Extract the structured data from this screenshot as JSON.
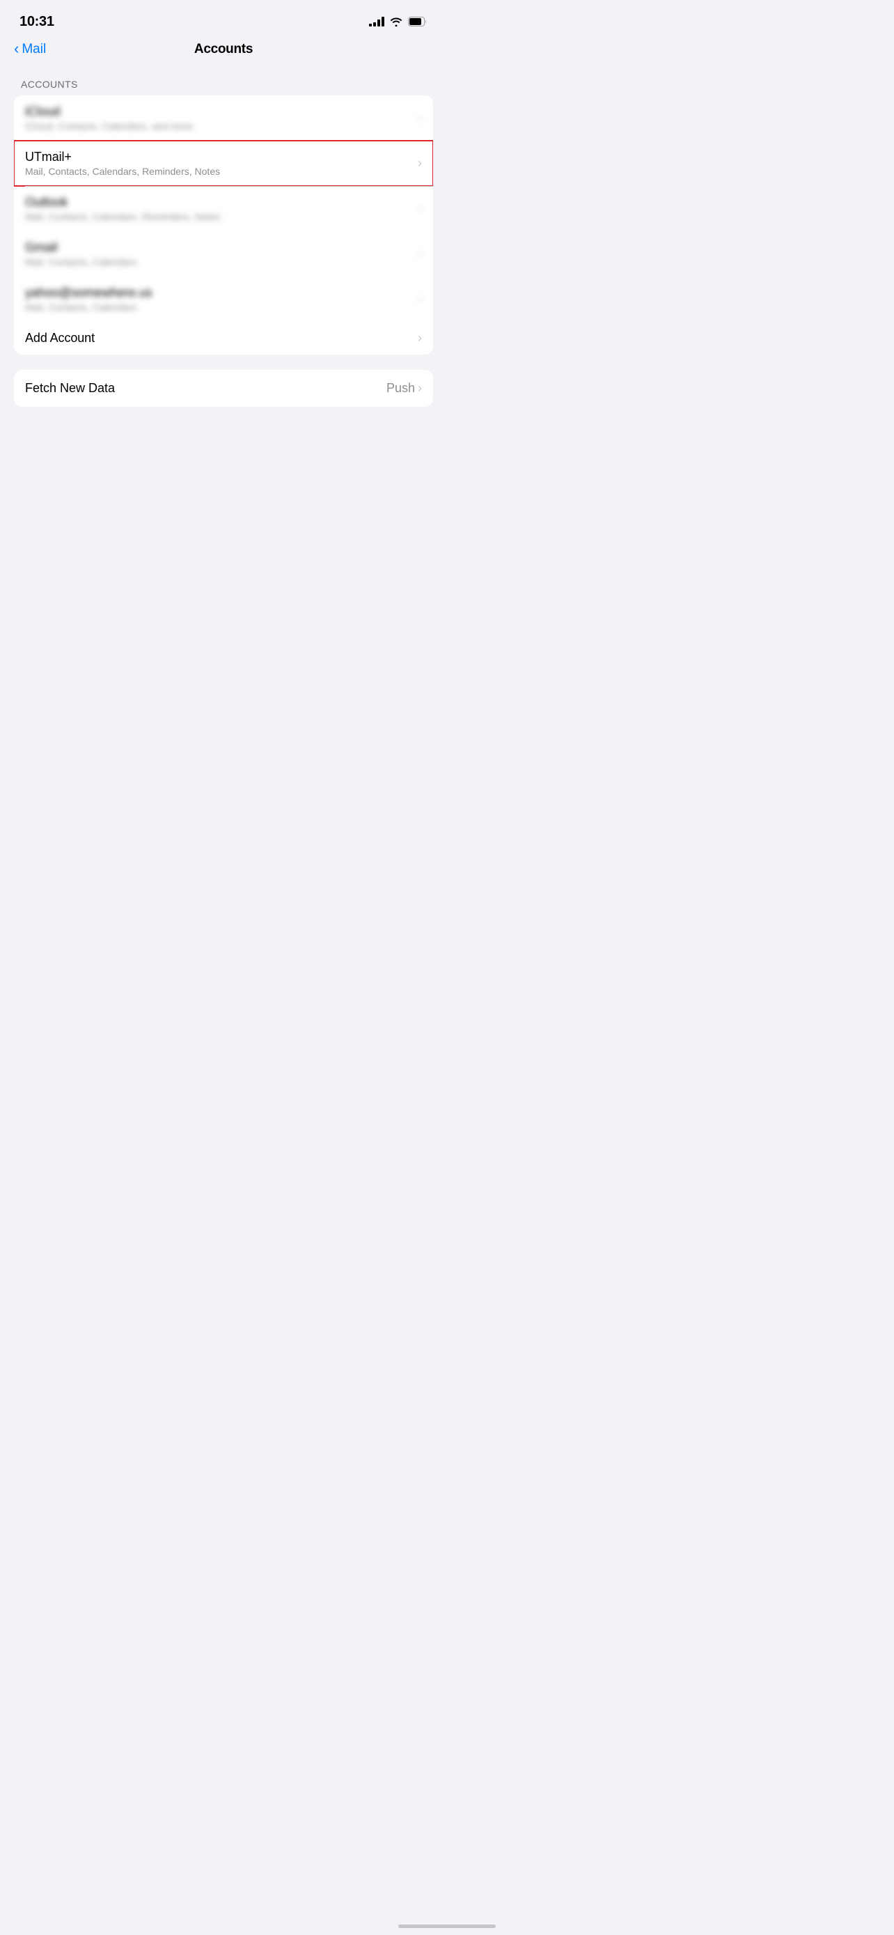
{
  "statusBar": {
    "time": "10:31"
  },
  "navBar": {
    "backLabel": "Mail",
    "title": "Accounts"
  },
  "accountsSection": {
    "sectionHeader": "ACCOUNTS",
    "accounts": [
      {
        "id": "icloud",
        "title": "iCloud",
        "subtitle": "iCloud, Contacts, Calendars, and more",
        "blurred": true,
        "highlighted": false
      },
      {
        "id": "utmail",
        "title": "UTmail+",
        "subtitle": "Mail, Contacts, Calendars, Reminders, Notes",
        "blurred": false,
        "highlighted": true
      },
      {
        "id": "outlook",
        "title": "Outlook",
        "subtitle": "Mail, Contacts, Calendars, Reminders, Notes",
        "blurred": true,
        "highlighted": false
      },
      {
        "id": "gmail",
        "title": "Gmail",
        "subtitle": "Mail, Contacts, Calendars",
        "blurred": true,
        "highlighted": false
      },
      {
        "id": "yahoo",
        "title": "yahoo@somewhere.us",
        "subtitle": "Mail, Contacts, Calendars",
        "blurred": true,
        "highlighted": false
      }
    ],
    "addAccount": {
      "label": "Add Account"
    }
  },
  "fetchNewData": {
    "label": "Fetch New Data",
    "value": "Push"
  }
}
